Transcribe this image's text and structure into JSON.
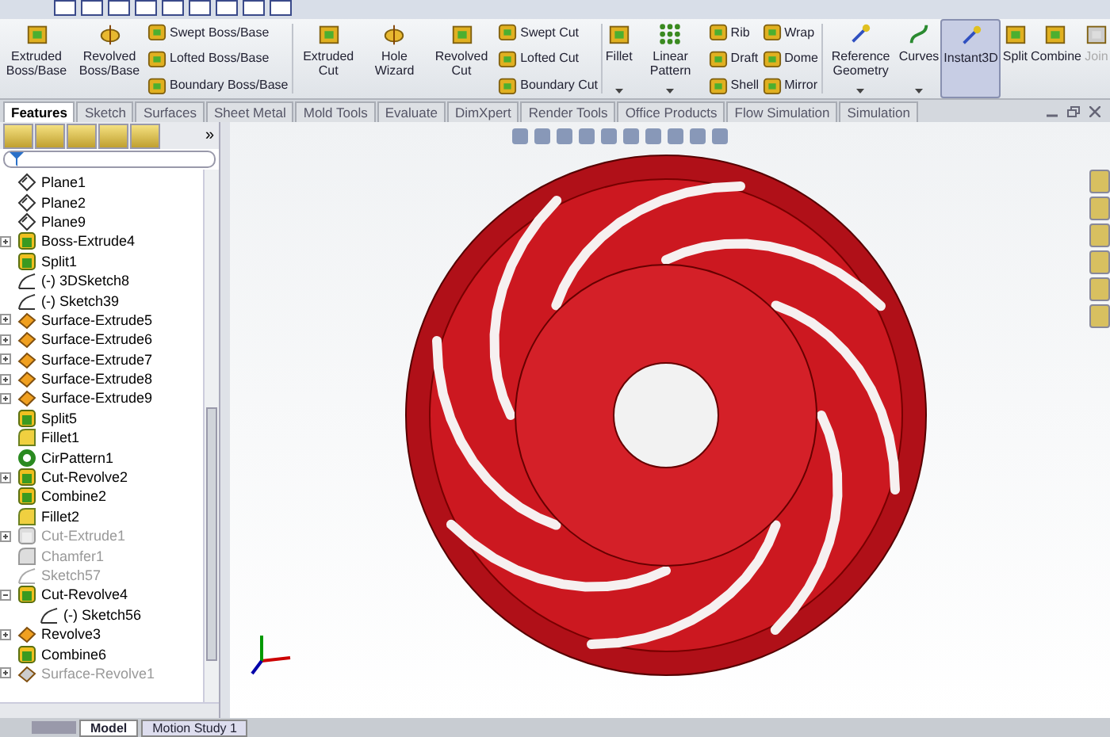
{
  "ribbon": [
    {
      "kind": "large",
      "label": "Extruded Boss/Base"
    },
    {
      "kind": "large",
      "label": "Revolved Boss/Base"
    },
    {
      "kind": "stack",
      "items": [
        "Swept Boss/Base",
        "Lofted Boss/Base",
        "Boundary Boss/Base"
      ]
    },
    {
      "kind": "sep"
    },
    {
      "kind": "large",
      "label": "Extruded Cut"
    },
    {
      "kind": "large",
      "label": "Hole Wizard"
    },
    {
      "kind": "large",
      "label": "Revolved Cut"
    },
    {
      "kind": "stack",
      "items": [
        "Swept Cut",
        "Lofted Cut",
        "Boundary Cut"
      ]
    },
    {
      "kind": "sep"
    },
    {
      "kind": "large",
      "label": "Fillet",
      "dropdown": true
    },
    {
      "kind": "large",
      "label": "Linear Pattern",
      "dropdown": true
    },
    {
      "kind": "stack",
      "items": [
        "Rib",
        "Draft",
        "Shell"
      ]
    },
    {
      "kind": "stack",
      "items": [
        "Wrap",
        "Dome",
        "Mirror"
      ]
    },
    {
      "kind": "sep"
    },
    {
      "kind": "large",
      "label": "Reference Geometry",
      "dropdown": true
    },
    {
      "kind": "large",
      "label": "Curves",
      "dropdown": true
    },
    {
      "kind": "large",
      "label": "Instant3D",
      "selected": true
    },
    {
      "kind": "large",
      "label": "Split"
    },
    {
      "kind": "large",
      "label": "Combine"
    },
    {
      "kind": "large",
      "label": "Join",
      "disabled": true
    }
  ],
  "tabs": [
    {
      "label": "Features",
      "selected": true
    },
    {
      "label": "Sketch",
      "selected": false
    },
    {
      "label": "Surfaces",
      "selected": false
    },
    {
      "label": "Sheet Metal",
      "selected": false
    },
    {
      "label": "Mold Tools",
      "selected": false
    },
    {
      "label": "Evaluate",
      "selected": false
    },
    {
      "label": "DimXpert",
      "selected": false
    },
    {
      "label": "Render Tools",
      "selected": false
    },
    {
      "label": "Office Products",
      "selected": false
    },
    {
      "label": "Flow Simulation",
      "selected": false
    },
    {
      "label": "Simulation",
      "selected": false
    }
  ],
  "panel_more": "»",
  "tree": [
    {
      "label": "Plane1",
      "kind": "plane",
      "expandable": false,
      "suppressed": false
    },
    {
      "label": "Plane2",
      "kind": "plane",
      "expandable": false,
      "suppressed": false
    },
    {
      "label": "Plane9",
      "kind": "plane",
      "expandable": false,
      "suppressed": false
    },
    {
      "label": "Boss-Extrude4",
      "kind": "feature",
      "expandable": true,
      "suppressed": false
    },
    {
      "label": "Split1",
      "kind": "feature",
      "expandable": false,
      "suppressed": false
    },
    {
      "label": "(-) 3DSketch8",
      "kind": "sketch",
      "expandable": false,
      "suppressed": false
    },
    {
      "label": "(-) Sketch39",
      "kind": "sketch",
      "expandable": false,
      "suppressed": false
    },
    {
      "label": "Surface-Extrude5",
      "kind": "surface",
      "expandable": true,
      "suppressed": false
    },
    {
      "label": "Surface-Extrude6",
      "kind": "surface",
      "expandable": true,
      "suppressed": false
    },
    {
      "label": "Surface-Extrude7",
      "kind": "surface",
      "expandable": true,
      "suppressed": false
    },
    {
      "label": "Surface-Extrude8",
      "kind": "surface",
      "expandable": true,
      "suppressed": false
    },
    {
      "label": "Surface-Extrude9",
      "kind": "surface",
      "expandable": true,
      "suppressed": false
    },
    {
      "label": "Split5",
      "kind": "feature",
      "expandable": false,
      "suppressed": false
    },
    {
      "label": "Fillet1",
      "kind": "fillet",
      "expandable": false,
      "suppressed": false
    },
    {
      "label": "CirPattern1",
      "kind": "pattern",
      "expandable": false,
      "suppressed": false
    },
    {
      "label": "Cut-Revolve2",
      "kind": "feature",
      "expandable": true,
      "suppressed": false
    },
    {
      "label": "Combine2",
      "kind": "feature",
      "expandable": false,
      "suppressed": false
    },
    {
      "label": "Fillet2",
      "kind": "fillet",
      "expandable": false,
      "suppressed": false
    },
    {
      "label": "Cut-Extrude1",
      "kind": "feature",
      "expandable": true,
      "suppressed": true
    },
    {
      "label": "Chamfer1",
      "kind": "fillet",
      "expandable": false,
      "suppressed": true
    },
    {
      "label": "Sketch57",
      "kind": "sketch",
      "expandable": false,
      "suppressed": true
    },
    {
      "label": "Cut-Revolve4",
      "kind": "feature",
      "expandable": true,
      "suppressed": false,
      "children": [
        {
          "label": "(-) Sketch56",
          "kind": "sketch",
          "expandable": false,
          "suppressed": false
        }
      ]
    },
    {
      "label": "Revolve3",
      "kind": "surface",
      "expandable": true,
      "suppressed": false
    },
    {
      "label": "Combine6",
      "kind": "feature",
      "expandable": false,
      "suppressed": false
    },
    {
      "label": "Surface-Revolve1",
      "kind": "surface",
      "expandable": true,
      "suppressed": true
    }
  ],
  "bottom_tabs": [
    {
      "label": "Model",
      "selected": true
    },
    {
      "label": "Motion Study 1",
      "selected": false
    }
  ]
}
